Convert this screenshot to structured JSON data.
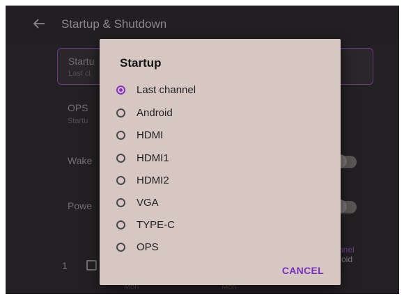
{
  "appbar": {
    "title": "Startup & Shutdown"
  },
  "background": {
    "startup_row": {
      "title_partial": "Startu",
      "sub_partial": "Last cl"
    },
    "ops_row": {
      "title_partial": "OPS",
      "sub_partial": "Startu"
    },
    "wake_label": "Wake",
    "power_label": "Powe",
    "schedule_index": "1",
    "link_partial": "nnel",
    "value_partial": "roid",
    "day_left": "Mon",
    "day_right": "Mon"
  },
  "dialog": {
    "title": "Startup",
    "options": [
      {
        "label": "Last channel",
        "selected": true
      },
      {
        "label": "Android",
        "selected": false
      },
      {
        "label": "HDMI",
        "selected": false
      },
      {
        "label": "HDMI1",
        "selected": false
      },
      {
        "label": "HDMI2",
        "selected": false
      },
      {
        "label": "VGA",
        "selected": false
      },
      {
        "label": "TYPE-C",
        "selected": false
      },
      {
        "label": "OPS",
        "selected": false
      }
    ],
    "cancel_label": "CANCEL"
  },
  "colors": {
    "accent": "#8b2fc9",
    "dialog_bg": "#d6c7c3",
    "screen_bg": "#1c1a1c"
  }
}
